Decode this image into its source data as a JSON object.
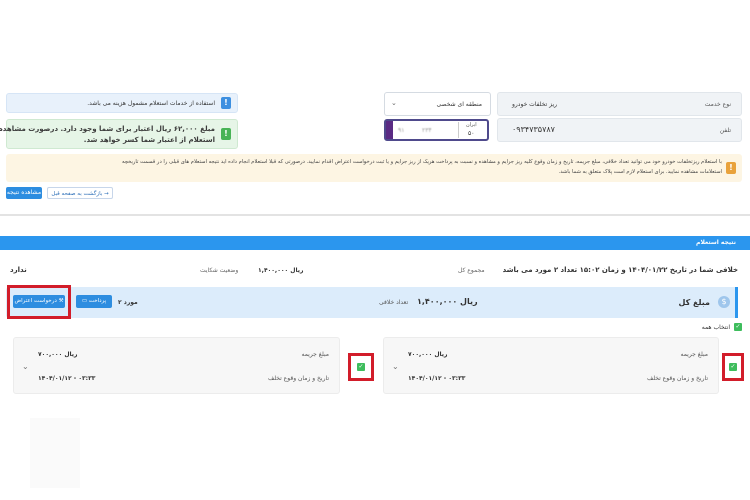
{
  "notices": {
    "fee_notice": "استفاده از خدمات استعلام مشمول هزینه می باشد.",
    "credit_notice_line1": "مبلغ ۶۲,۰۰۰ ریال اعتبار برای شما وجود دارد. درصورت مشاهده نتیجه",
    "credit_notice_line2": "استعلام از اعتبار شما کسر خواهد شد.",
    "warning_line1": "با استعلام ریزتخلفات خودرو خود می توانید تعداد خلافی، مبلغ جریمه، تاریخ و زمان وقوع کلیه ریز جرایم و مشاهده و نسبت به پرداخت هریک از ریز جرایم و یا ثبت درخواست اعتراض اقدام نمایید. درصورتی که قبلا استعلام انجام داده اید نتیجه استعلام های قبلی را در قسمت تاریخچه",
    "warning_line2": "استعلامات مشاهده نمایید. برای استعلام لازم است پلاک متعلق به شما باشد."
  },
  "form": {
    "service_type_label": "نوع خدمت",
    "service_type_value": "ریز تخلفات خودرو",
    "region_value": "منطقه ای شخصی",
    "mobile_label": "تلفن",
    "mobile_value": "۰۹۳۴۷۳۵۷۸۷",
    "plate_province_label": "ایران",
    "plate_province_code": "۵۰",
    "plate_number": "۲۳۴",
    "plate_letter": "۹۱"
  },
  "actions": {
    "view_result": "مشاهده نتیجه",
    "back": "بازگشت به صفحه قبل"
  },
  "result": {
    "header": "نتیجه استعلام",
    "summary": "خلافی شما در تاریخ ۱۴۰۴/۰۱/۲۲ و زمان ۱۵:۰۲ تعداد ۲ مورد می باشد",
    "total_label": "مجموع کل",
    "total_value": "۱,۴۰۰,۰۰۰ ریال",
    "complaint_label": "وضعیت شکایت",
    "complaint_value": "ندارد",
    "sum_title": "مبلغ کل",
    "sum_value": "۱,۴۰۰,۰۰۰ ریال",
    "count_label": "تعداد خلافی",
    "count_value": "۲ مورد",
    "pay_button": "پرداخت",
    "objection_button": "درخواست اعتراض",
    "select_all": "انتخاب همه"
  },
  "violations": [
    {
      "fine_label": "مبلغ جریمه",
      "fine_value": "۷۰۰,۰۰۰ ریال",
      "datetime_label": "تاریخ و زمان وقوع تخلف",
      "datetime_value": "۱۴۰۴/۰۱/۱۲ - ۰۳:۳۳"
    },
    {
      "fine_label": "مبلغ جریمه",
      "fine_value": "۷۰۰,۰۰۰ ریال",
      "datetime_label": "تاریخ و زمان وقوع تخلف",
      "datetime_value": "۱۴۰۴/۰۱/۱۲ - ۰۳:۳۳"
    }
  ],
  "colors": {
    "accent": "#2d8de0",
    "header_bar": "#2b96ee",
    "highlight": "#d21d2a",
    "success": "#3ebd5d"
  }
}
